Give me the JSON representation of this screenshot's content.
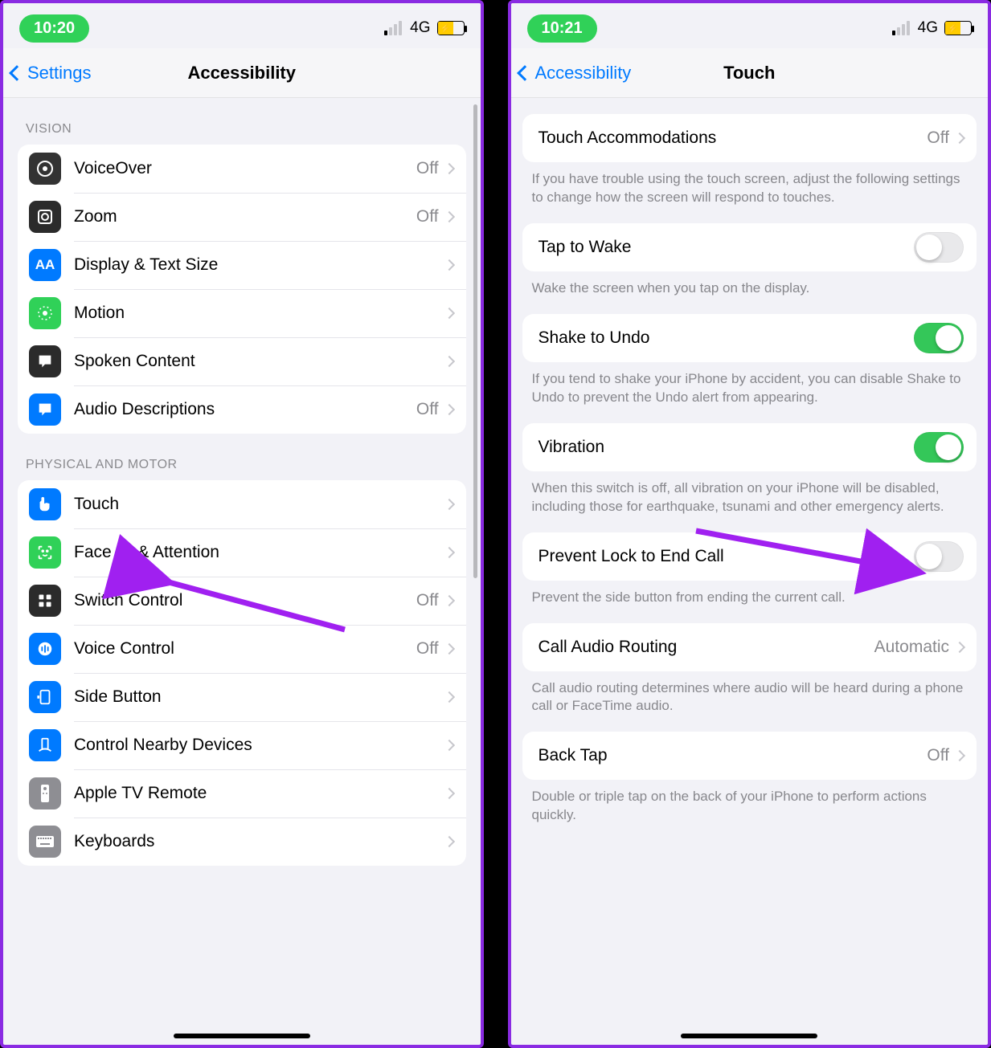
{
  "left": {
    "status": {
      "time": "10:20",
      "network": "4G"
    },
    "nav": {
      "back": "Settings",
      "title": "Accessibility"
    },
    "sections": {
      "vision": {
        "header": "VISION",
        "items": [
          {
            "label": "VoiceOver",
            "value": "Off"
          },
          {
            "label": "Zoom",
            "value": "Off"
          },
          {
            "label": "Display & Text Size",
            "value": ""
          },
          {
            "label": "Motion",
            "value": ""
          },
          {
            "label": "Spoken Content",
            "value": ""
          },
          {
            "label": "Audio Descriptions",
            "value": "Off"
          }
        ]
      },
      "physical": {
        "header": "PHYSICAL AND MOTOR",
        "items": [
          {
            "label": "Touch",
            "value": ""
          },
          {
            "label": "Face ID & Attention",
            "value": ""
          },
          {
            "label": "Switch Control",
            "value": "Off"
          },
          {
            "label": "Voice Control",
            "value": "Off"
          },
          {
            "label": "Side Button",
            "value": ""
          },
          {
            "label": "Control Nearby Devices",
            "value": ""
          },
          {
            "label": "Apple TV Remote",
            "value": ""
          },
          {
            "label": "Keyboards",
            "value": ""
          }
        ]
      }
    }
  },
  "right": {
    "status": {
      "time": "10:21",
      "network": "4G"
    },
    "nav": {
      "back": "Accessibility",
      "title": "Touch"
    },
    "rows": {
      "touchAccommodations": {
        "label": "Touch Accommodations",
        "value": "Off"
      },
      "touchAccommodationsFooter": "If you have trouble using the touch screen, adjust the following settings to change how the screen will respond to touches.",
      "tapToWake": {
        "label": "Tap to Wake",
        "on": false
      },
      "tapToWakeFooter": "Wake the screen when you tap on the display.",
      "shakeToUndo": {
        "label": "Shake to Undo",
        "on": true
      },
      "shakeToUndoFooter": "If you tend to shake your iPhone by accident, you can disable Shake to Undo to prevent the Undo alert from appearing.",
      "vibration": {
        "label": "Vibration",
        "on": true
      },
      "vibrationFooter": "When this switch is off, all vibration on your iPhone will be disabled, including those for earthquake, tsunami and other emergency alerts.",
      "preventLock": {
        "label": "Prevent Lock to End Call",
        "on": false
      },
      "preventLockFooter": "Prevent the side button from ending the current call.",
      "callAudio": {
        "label": "Call Audio Routing",
        "value": "Automatic"
      },
      "callAudioFooter": "Call audio routing determines where audio will be heard during a phone call or FaceTime audio.",
      "backTap": {
        "label": "Back Tap",
        "value": "Off"
      },
      "backTapFooter": "Double or triple tap on the back of your iPhone to perform actions quickly."
    }
  }
}
